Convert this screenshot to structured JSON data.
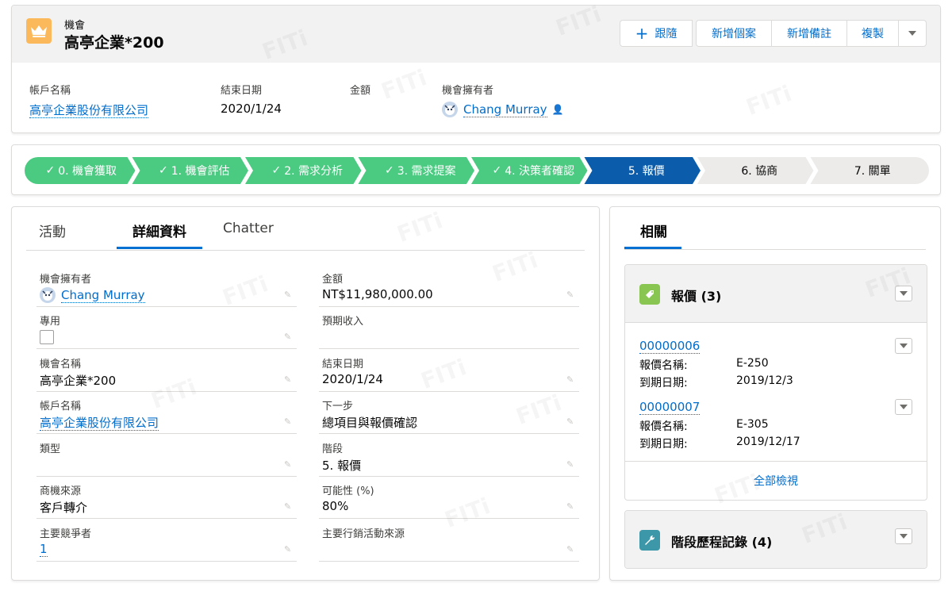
{
  "header": {
    "object_label": "機會",
    "record_title": "高亭企業*200",
    "buttons": {
      "follow": "跟隨",
      "new_case": "新增個案",
      "new_note": "新增備註",
      "clone": "複製"
    },
    "fields": {
      "account_label": "帳戶名稱",
      "account_value": "高亭企業股份有限公司",
      "close_label": "結束日期",
      "close_value": "2020/1/24",
      "amount_label": "金額",
      "owner_label": "機會擁有者",
      "owner_value": "Chang Murray"
    }
  },
  "path": {
    "stages": [
      {
        "label": "0. 機會獲取",
        "status": "complete"
      },
      {
        "label": "1. 機會評估",
        "status": "complete"
      },
      {
        "label": "2. 需求分析",
        "status": "complete"
      },
      {
        "label": "3. 需求提案",
        "status": "complete"
      },
      {
        "label": "4. 決策者確認",
        "status": "complete"
      },
      {
        "label": "5. 報價",
        "status": "current"
      },
      {
        "label": "6. 協商",
        "status": "incomplete"
      },
      {
        "label": "7. 關單",
        "status": "incomplete"
      }
    ],
    "complete_color": "#4bca81",
    "current_color": "#0b5cab",
    "incomplete_color": "#ecebea"
  },
  "tabs": {
    "activity": "活動",
    "details": "詳細資料",
    "chatter": "Chatter"
  },
  "details": {
    "owner_label": "機會擁有者",
    "owner_value": "Chang Murray",
    "amount_label": "金額",
    "amount_value": "NT$11,980,000.00",
    "private_label": "專用",
    "private_checked": false,
    "expected_label": "預期收入",
    "expected_value": "",
    "name_label": "機會名稱",
    "name_value": "高亭企業*200",
    "close_label": "結束日期",
    "close_value": "2020/1/24",
    "account_label": "帳戶名稱",
    "account_value": "高亭企業股份有限公司",
    "next_label": "下一步",
    "next_value": "總項目與報價確認",
    "type_label": "類型",
    "type_value": "",
    "stage_label": "階段",
    "stage_value": "5. 報價",
    "source_label": "商機來源",
    "source_value": "客戶轉介",
    "prob_label": "可能性 (%)",
    "prob_value": "80%",
    "competitor_label": "主要競爭者",
    "competitor_value": "1",
    "campaign_label": "主要行銷活動來源",
    "campaign_value": ""
  },
  "related": {
    "tab": "相關",
    "quotes": {
      "title": "報價 (3)",
      "items": [
        {
          "number": "00000006",
          "name_label": "報價名稱:",
          "name_value": "E-250",
          "exp_label": "到期日期:",
          "exp_value": "2019/12/3"
        },
        {
          "number": "00000007",
          "name_label": "報價名稱:",
          "name_value": "E-305",
          "exp_label": "到期日期:",
          "exp_value": "2019/12/17"
        }
      ],
      "view_all": "全部檢視"
    },
    "stage_history": {
      "title": "階段歷程記錄 (4)"
    }
  },
  "watermark": "FITi"
}
